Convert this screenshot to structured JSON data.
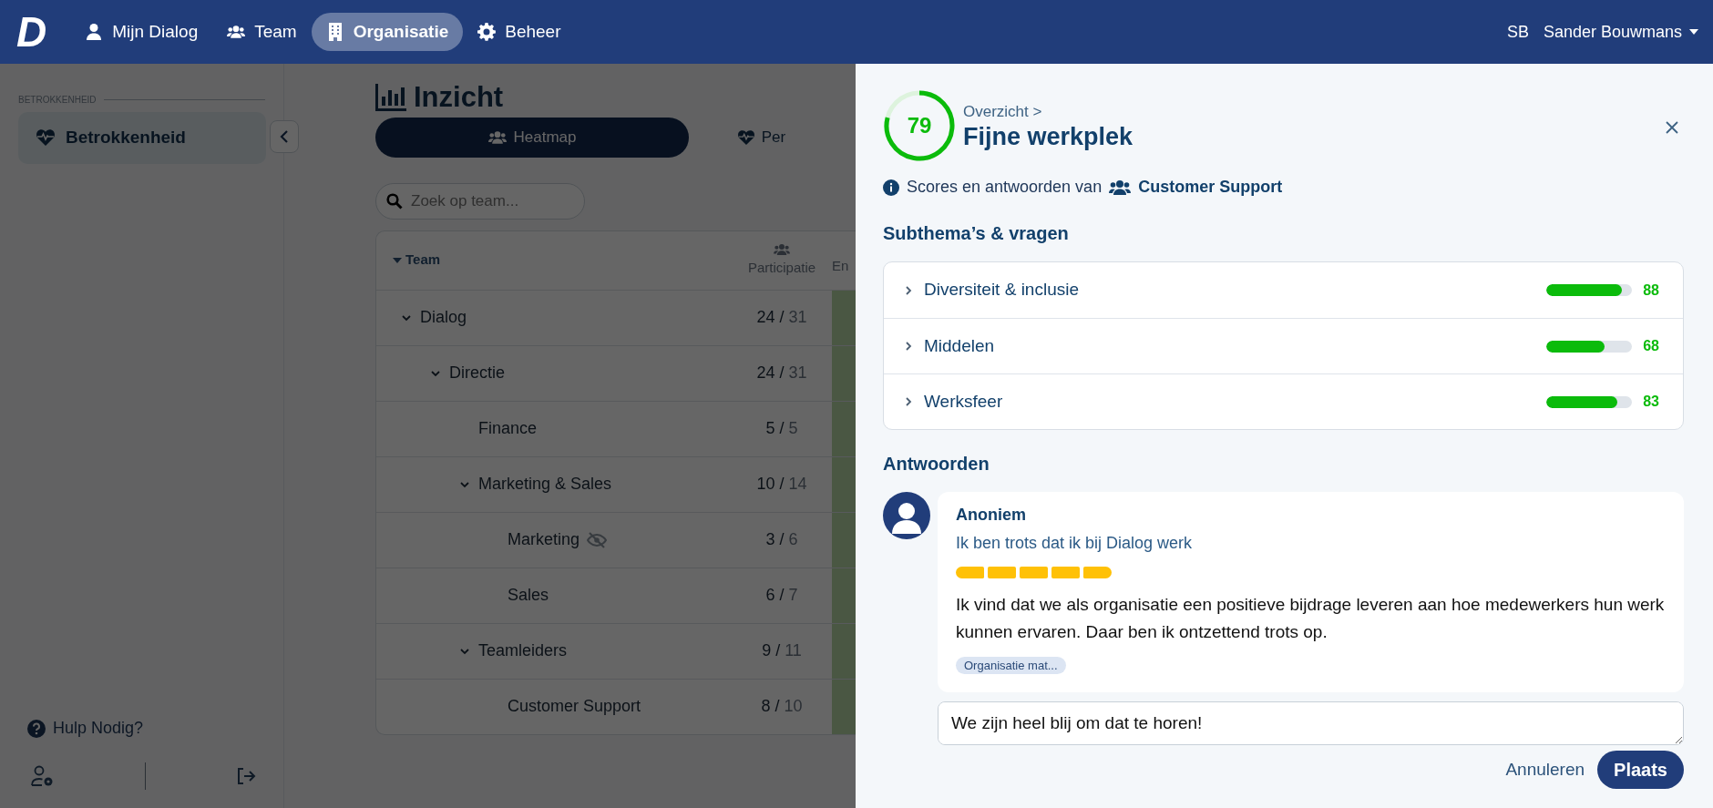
{
  "nav": {
    "logo": "D",
    "items": [
      {
        "label": "Mijn Dialog",
        "selected": false
      },
      {
        "label": "Team",
        "selected": false
      },
      {
        "label": "Organisatie",
        "selected": true
      },
      {
        "label": "Beheer",
        "selected": false
      }
    ],
    "user": {
      "initials": "SB",
      "name": "Sander Bouwmans"
    }
  },
  "sidebar": {
    "section": "BETROKKENHEID",
    "items": [
      {
        "label": "Betrokkenheid",
        "selected": true
      }
    ],
    "help": "Hulp Nodig?"
  },
  "main": {
    "title": "Inzicht",
    "tabs": [
      {
        "label": "Heatmap",
        "selected": true
      },
      {
        "label": "Per",
        "selected": false
      }
    ],
    "search": {
      "placeholder": "Zoek op team..."
    },
    "table": {
      "columns": [
        {
          "label": "Team",
          "sorted": true
        },
        {
          "label": "Participatie"
        },
        {
          "label": "En"
        }
      ],
      "rows": [
        {
          "team": "Dialog",
          "answered": "24 /",
          "total": "31",
          "hidden": false,
          "expanded": true,
          "children": [
            {
              "team": "Directie",
              "answered": "24 /",
              "total": "31",
              "hidden": false,
              "expanded": true,
              "children": [
                {
                  "team": "Finance",
                  "answered": "5 /",
                  "total": "5",
                  "hidden": false
                },
                {
                  "team": "Marketing & Sales",
                  "answered": "10 /",
                  "total": "14",
                  "hidden": false,
                  "expanded": true,
                  "children": [
                    {
                      "team": "Marketing",
                      "answered": "3 /",
                      "total": "6",
                      "hidden": true
                    },
                    {
                      "team": "Sales",
                      "answered": "6 /",
                      "total": "7",
                      "hidden": false
                    }
                  ]
                },
                {
                  "team": "Teamleiders",
                  "answered": "9 /",
                  "total": "11",
                  "hidden": false,
                  "expanded": true,
                  "children": [
                    {
                      "team": "Customer Support",
                      "answered": "8 /",
                      "total": "10",
                      "hidden": false
                    }
                  ]
                }
              ]
            }
          ]
        }
      ]
    }
  },
  "panel": {
    "score": "79",
    "breadcrumb": "Overzicht >",
    "title": "Fijne werkplek",
    "info": "Scores en antwoorden van",
    "team": "Customer Support",
    "subthemes_title": "Subthema’s & vragen",
    "subthemes": [
      {
        "label": "Diversiteit & inclusie",
        "level": 0.88,
        "score": "88",
        "expanded": false
      },
      {
        "label": "Middelen",
        "level": 0.68,
        "score": "68",
        "expanded": false
      },
      {
        "label": "Werksfeer",
        "level": 0.83,
        "score": "83",
        "expanded": false
      }
    ],
    "answers_title": "Antwoorden",
    "answers": [
      {
        "author": "Anoniem",
        "question": "Ik ben trots dat ik bij Dialog werk",
        "stars": 5,
        "text": "Ik vind dat we als organisatie een positieve bijdrage leveren aan hoe medewerkers hun werk kunnen ervaren. Daar ben ik ontzettend trots op.",
        "tag": "Organisatie mat..."
      }
    ],
    "reply": {
      "value": "We zijn heel blij om dat te horen!"
    },
    "cancel": "Annuleren",
    "submit": "Plaats"
  }
}
